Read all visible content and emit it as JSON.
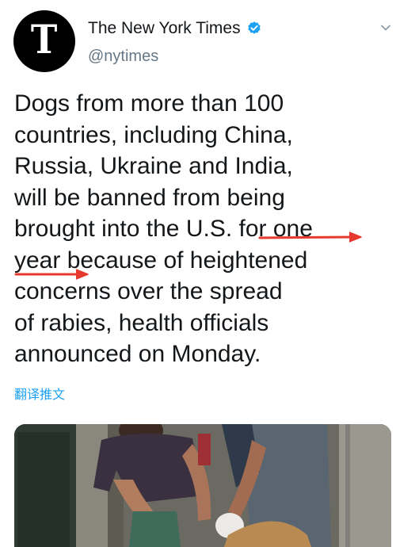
{
  "tweet": {
    "display_name": "The New York Times",
    "handle": "@nytimes",
    "avatar_letter": "T",
    "verified_icon": "verified-badge-icon",
    "more_icon": "chevron-down-icon",
    "text_lines": [
      "Dogs from more than 100",
      "countries, including China,",
      "Russia, Ukraine and India,",
      "will be banned from being",
      "brought into the U.S. for one",
      "year because of heightened",
      "concerns over the spread",
      "of rabies, health officials",
      "announced on Monday."
    ],
    "translate_label": "翻译推文",
    "media": {
      "type": "photo"
    }
  },
  "colors": {
    "text": "#14171a",
    "secondary": "#657786",
    "link": "#1da1f2",
    "verified": "#1da1f2",
    "annotation": "#e8392f"
  }
}
